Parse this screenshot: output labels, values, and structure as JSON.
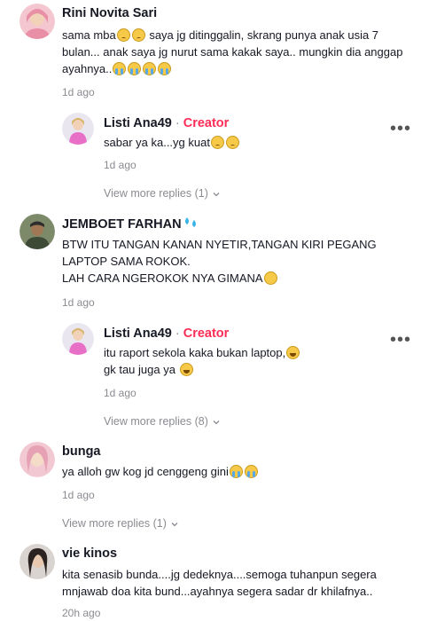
{
  "comments": [
    {
      "username": "Rini Novita Sari",
      "text": "sama mba😢😢 saya jg ditinggalin, skrang punya anak usia 7 bulan... anak saya jg nurut sama kakak saya.. mungkin dia anggap ayahnya..😭😭😭😭",
      "time": "1d ago",
      "reply": {
        "username": "Listi Ana49",
        "badge": "Creator",
        "text": "sabar ya ka...yg kuat😕😢",
        "time": "1d ago"
      },
      "view_more": "View more replies (1)"
    },
    {
      "username": "JEMBOET FARHAN",
      "text": "BTW ITU TANGAN KANAN NYETIR,TANGAN KIRI PEGANG LAPTOP SAMA ROKOK.\nLAH CARA NGEROKOK NYA GIMANA😳",
      "time": "1d ago",
      "reply": {
        "username": "Listi Ana49",
        "badge": "Creator",
        "text": "itu raport sekola kaka bukan laptop,😁\ngk tau juga ya 😂",
        "time": "1d ago"
      },
      "view_more": "View more replies (8)"
    },
    {
      "username": "bunga",
      "text": "ya alloh gw kog jd cenggeng gini😭😭",
      "time": "1d ago",
      "view_more": "View more replies (1)"
    },
    {
      "username": "vie kinos",
      "text": "kita senasib bunda....jg dedeknya....semoga tuhanpun segera mnjawab doa kita bund...ayahnya segera sadar dr khilafnya..",
      "time": "20h ago"
    }
  ]
}
